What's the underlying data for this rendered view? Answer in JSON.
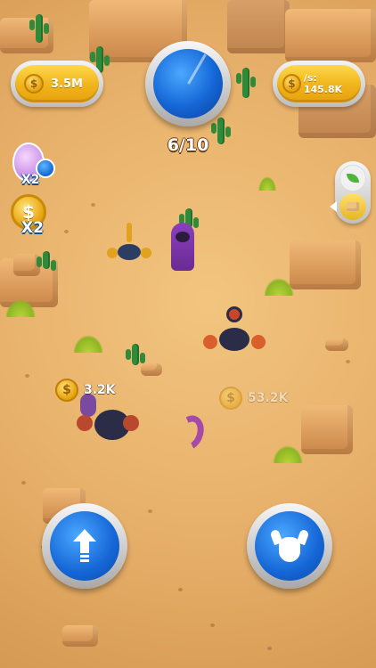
{
  "hud": {
    "coins_label": "3.5M",
    "income_label": "/s: 145.8K",
    "coin_symbol": "$"
  },
  "spawn_counter": "6/10",
  "boosters": {
    "egg_multiplier": "X2",
    "coin_multiplier": "X2"
  },
  "floating_income": [
    {
      "amount": "3.2K"
    },
    {
      "amount": "53.2K"
    }
  ],
  "icons": {
    "upgrade": "arrow-up-icon",
    "monster": "horned-monster-icon",
    "toggle_plants": "leaf-icon",
    "toggle_rocks": "rock-icon"
  },
  "colors": {
    "sand": "#e9b36a",
    "gold": "#f0b31b",
    "blue": "#1566d6"
  }
}
